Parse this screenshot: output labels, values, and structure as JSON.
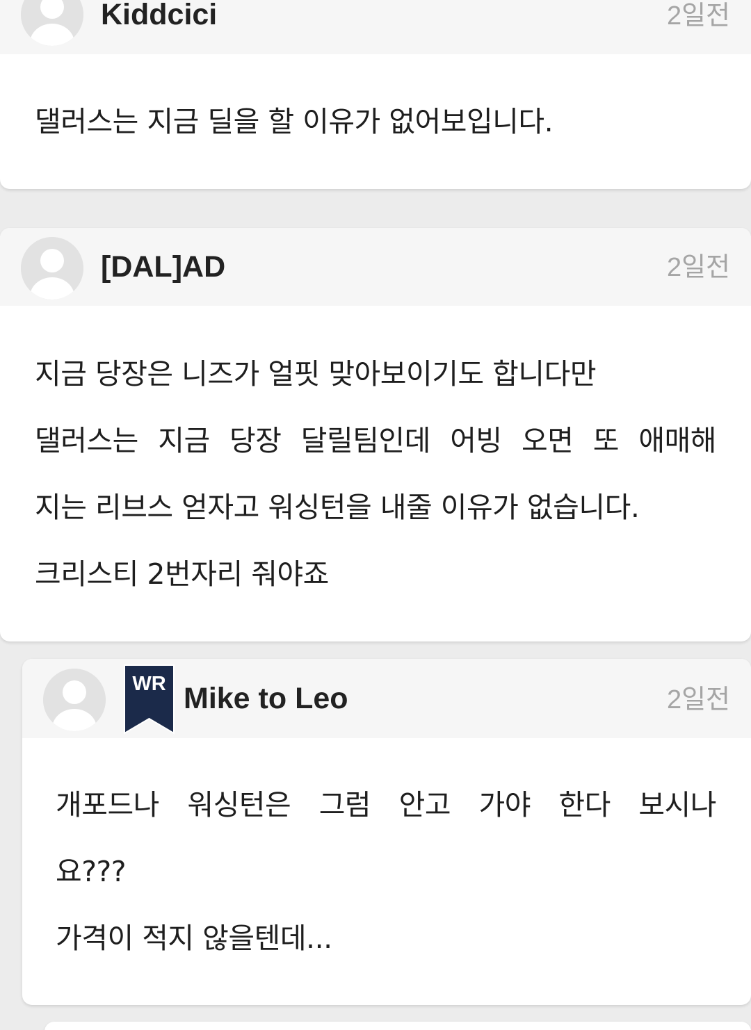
{
  "comments": [
    {
      "author": "Kiddcici",
      "time": "2일전",
      "lines": [
        "댈러스는 지금 딜을 할 이유가 없어보입니다."
      ]
    },
    {
      "author": "[DAL]AD",
      "time": "2일전",
      "lines": [
        "지금 당장은 니즈가 얼핏 맞아보이기도 합니다만",
        "댈러스는 지금 당장 달릴팀인데 어빙 오면 또 애매해",
        "지는 리브스 얻자고 워싱턴을 내줄 이유가 없습니다.",
        "크리스티 2번자리 줘야죠"
      ]
    },
    {
      "author": "Mike to Leo",
      "badge": "WR",
      "time": "2일전",
      "lines": [
        "개포드나 워싱턴은 그럼 안고 가야 한다 보시나",
        "요???",
        "가격이 적지 않을텐데..."
      ]
    }
  ],
  "colors": {
    "background": "#ececec",
    "card": "#ffffff",
    "header": "#f6f6f6",
    "badge": "#1b2a4a",
    "time": "#a5a5a5"
  }
}
